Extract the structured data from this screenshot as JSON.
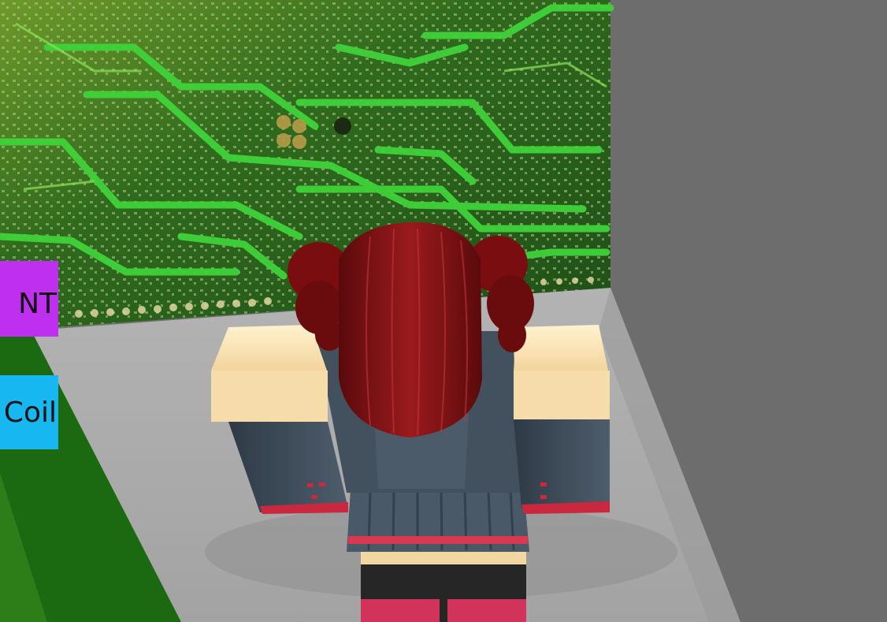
{
  "side_buttons": [
    {
      "label": "NT",
      "color": "#bf2ff0"
    },
    {
      "label": "Coil",
      "color": "#17b8f1"
    }
  ],
  "scene": {
    "description_icons": [
      "circuit-board-wall",
      "avatar",
      "floor"
    ],
    "colors": {
      "circuit_green": "#3fd23a",
      "floor": "#a6a6a6",
      "wall": "#707070",
      "hair": "#8a0f12",
      "skin": "#f8d9a4",
      "outfit": "#3d4a57"
    }
  }
}
